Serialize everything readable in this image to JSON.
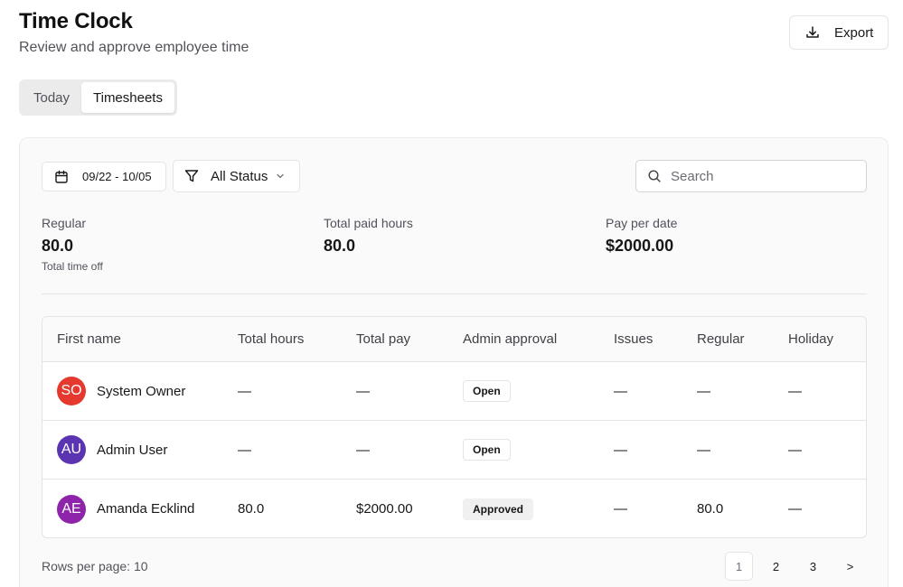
{
  "header": {
    "title": "Time Clock",
    "subtitle": "Review and approve employee time",
    "export_label": "Export"
  },
  "tabs": [
    {
      "label": "Today",
      "active": false
    },
    {
      "label": "Timesheets",
      "active": true
    }
  ],
  "filters": {
    "date_range": "09/22 - 10/05",
    "status": "All Status",
    "search_placeholder": "Search"
  },
  "stats": {
    "regular": {
      "label": "Regular",
      "value": "80.0",
      "sub": "Total time off"
    },
    "total_paid": {
      "label": "Total paid hours",
      "value": "80.0"
    },
    "pay": {
      "label": "Pay per date",
      "value": "$2000.00"
    }
  },
  "table": {
    "columns": [
      "First name",
      "Total hours",
      "Total pay",
      "Admin approval",
      "Issues",
      "Regular",
      "Holiday"
    ],
    "rows": [
      {
        "initials": "SO",
        "avatar_color": "#e5392f",
        "name": "System Owner",
        "total_hours": "—",
        "total_pay": "—",
        "approval": "Open",
        "issues": "—",
        "regular": "—",
        "holiday": "—"
      },
      {
        "initials": "AU",
        "avatar_color": "#5b35b1",
        "name": "Admin User",
        "total_hours": "—",
        "total_pay": "—",
        "approval": "Open",
        "issues": "—",
        "regular": "—",
        "holiday": "—"
      },
      {
        "initials": "AE",
        "avatar_color": "#8e24aa",
        "name": "Amanda Ecklind",
        "total_hours": "80.0",
        "total_pay": "$2000.00",
        "approval": "Approved",
        "issues": "—",
        "regular": "80.0",
        "holiday": "—"
      }
    ]
  },
  "footer": {
    "rows_per_page": "Rows per page: 10",
    "pages": [
      "1",
      "2",
      "3",
      ">"
    ],
    "current_page": "1"
  }
}
